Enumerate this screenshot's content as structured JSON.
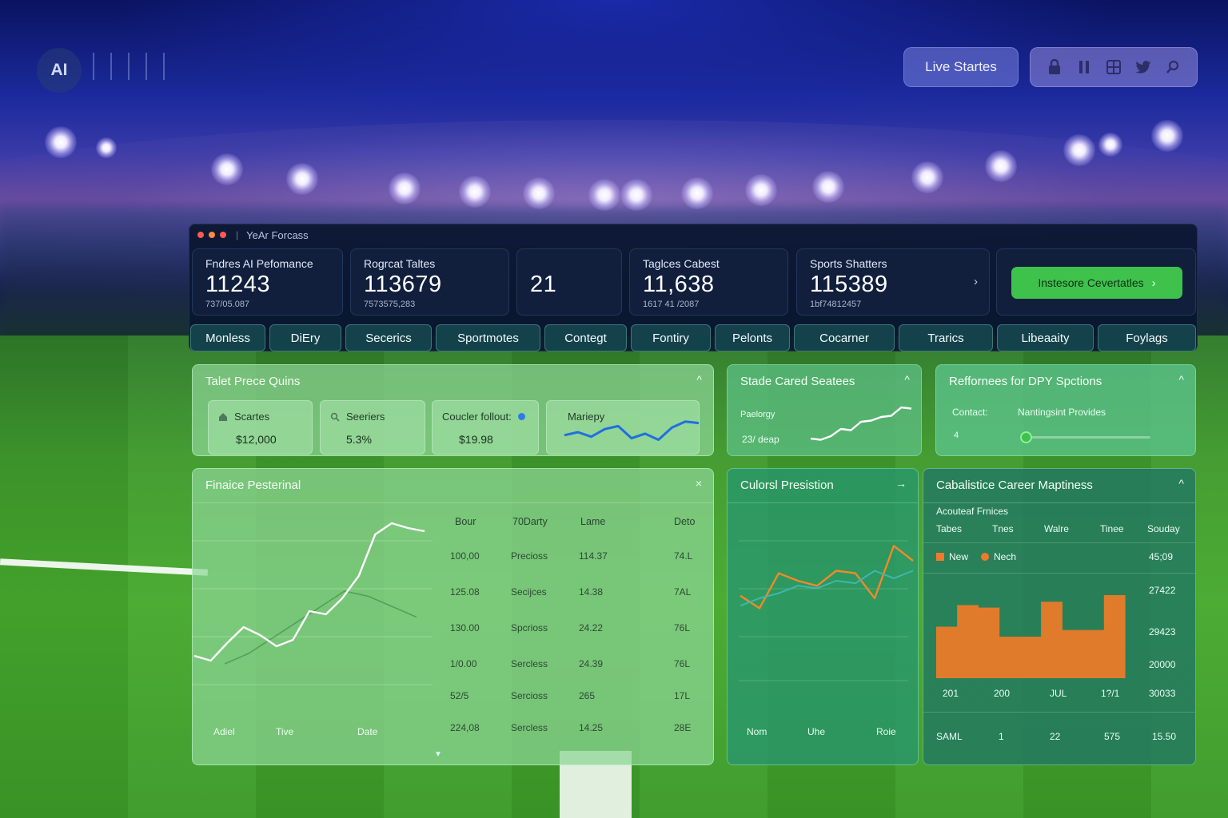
{
  "topbar": {
    "brand": "AI",
    "live_button": "Live Startes",
    "icons": [
      "lock-icon",
      "pause-icon",
      "grid-icon",
      "twitter-icon",
      "search-icon"
    ]
  },
  "window": {
    "title": "YeAr Forcass",
    "kpis": [
      {
        "label": "Fndres AI Pefomance",
        "value": "11243",
        "sub": "737/05.087"
      },
      {
        "label": "Rogrcat Taltes",
        "value": "113679",
        "sub": "7573575,283"
      },
      {
        "label": "",
        "value": "21",
        "sub": ""
      },
      {
        "label": "Taglces Cabest",
        "value": "11,638",
        "sub": "1617 41 /2087"
      },
      {
        "label": "Sports Shatters",
        "value": "115389",
        "sub": "1bf74812457"
      }
    ],
    "cta_label": "Instesore Cevertatles"
  },
  "tabs": [
    "Monless",
    "DiEry",
    "Secerics",
    "Sportmotes",
    "Contegt",
    "Fontiry",
    "Pelonts",
    "Cocarner",
    "Trarics",
    "Libeaaity",
    "Foylags"
  ],
  "price_card": {
    "title": "Talet Prece Quins",
    "minis": [
      {
        "label": "Scartes",
        "value": "$12,000",
        "icon": "home-icon"
      },
      {
        "label": "Seeriers",
        "value": "5.3%",
        "icon": "search-icon"
      },
      {
        "label": "Coucler follout:",
        "value": "$19.98",
        "icon": "info-dot-icon"
      },
      {
        "label": "Mariepy",
        "value": "",
        "icon": ""
      }
    ]
  },
  "stat_card": {
    "title": "Stade Cared Seatees",
    "labels": [
      "Paelorgy",
      "23/ deap"
    ]
  },
  "ref_card": {
    "title": "Reffornees for DPY Spctions",
    "contact_label": "Contact:",
    "provider": "Nantingsint Provides",
    "slider_mark": "4",
    "slider_fraction": 0.05
  },
  "finance_card": {
    "title": "Finaice Pesterinal",
    "columns": [
      "Bour",
      "70Darty",
      "Lame",
      "Deto"
    ],
    "rows": [
      [
        "100,00",
        "Precioss",
        "114.37",
        "74.L"
      ],
      [
        "125.08",
        "Secijces",
        "14.38",
        "7AL"
      ],
      [
        "130.00",
        "Spcrioss",
        "24.22",
        "76L"
      ],
      [
        "1/0.00",
        "Sercless",
        "24.39",
        "76L"
      ],
      [
        "52/5",
        "Sercioss",
        "265",
        "17L"
      ],
      [
        "224,08",
        "Sercless",
        "14.25",
        "28E"
      ]
    ],
    "axis": [
      "Adiel",
      "Tive",
      "Date"
    ]
  },
  "prediction_card": {
    "title": "Culorsl Presistion",
    "axis": [
      "Nom",
      "Uhe",
      "Roie"
    ]
  },
  "career_card": {
    "title": "Cabalistice Career Maptiness",
    "subtitle": "Acouteaf Frnices",
    "columns": [
      "Tabes",
      "Tnes",
      "Walre",
      "Tinee",
      "Souday"
    ],
    "legend": [
      {
        "name": "New",
        "color": "#f07a28",
        "shape": "square"
      },
      {
        "name": "Nech",
        "color": "#f07a28",
        "shape": "circle"
      }
    ],
    "y_ticks": [
      "45;09",
      "27422",
      "29423",
      "20000",
      "30033"
    ],
    "x_ticks": [
      "201",
      "200",
      "JUL",
      "1?/1"
    ],
    "footer": [
      "SAML",
      "1",
      "22",
      "575",
      "15.50"
    ]
  },
  "colors": {
    "accent_green": "#3ec24c",
    "bar_orange": "#e07b2c",
    "line_blue": "#1f6fe0",
    "line_orange": "#f08a2a",
    "line_teal": "#3fb6b0"
  },
  "chart_data": [
    {
      "type": "line",
      "title": "",
      "series": [
        {
          "values": [
            38,
            40,
            37,
            42,
            44,
            36,
            39,
            35,
            43,
            47,
            46
          ]
        }
      ]
    },
    {
      "type": "line",
      "title": "",
      "series": [
        {
          "values": [
            4,
            3,
            6,
            12,
            11,
            18,
            19,
            22,
            23,
            30,
            29
          ]
        }
      ]
    },
    {
      "type": "line",
      "title": "",
      "series": [
        {
          "values": [
            12,
            9,
            20,
            30,
            25,
            18,
            22,
            40,
            38,
            48,
            62,
            88,
            95,
            92,
            90
          ]
        },
        {
          "values": [
            8,
            12,
            18,
            24,
            30,
            36,
            34,
            30,
            26
          ]
        }
      ]
    },
    {
      "type": "line",
      "title": "",
      "series": [
        {
          "values": [
            20,
            10,
            38,
            32,
            28,
            40,
            38,
            18,
            60,
            48
          ]
        },
        {
          "values": [
            12,
            18,
            22,
            28,
            26,
            32,
            30,
            40,
            34,
            40
          ]
        }
      ]
    },
    {
      "type": "bar",
      "title": "",
      "values": [
        62,
        88,
        85,
        50,
        50,
        92,
        58,
        58,
        100
      ]
    }
  ]
}
